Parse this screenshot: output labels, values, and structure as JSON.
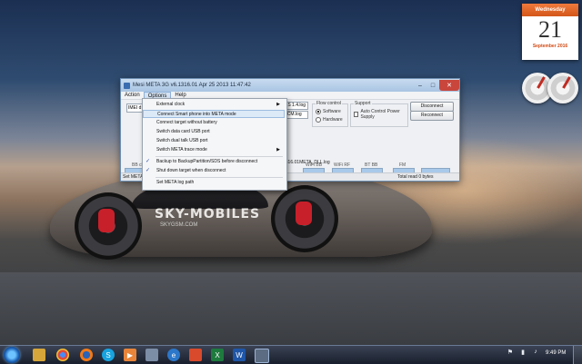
{
  "window": {
    "title": "Mesi META 3G v6.1316.01 Apr 25 2013 11:47:42",
    "minimize": "–",
    "maximize": "□",
    "close": "✕"
  },
  "menubar": [
    "Action",
    "Options",
    "Help"
  ],
  "form": {
    "imei_value": "IMEI d",
    "log_field_1": "ES 1.4.log",
    "log_field_2": "3CM.log",
    "flow_control_label": "Flow control",
    "flow_software": "Software",
    "flow_hardware": "Hardware",
    "support_label": "Support",
    "auto_power": "Auto Control Power Supply",
    "disconnect": "Disconnect",
    "reconnect": "Reconnect",
    "status_labels": [
      "BB ch",
      "WiFi BB",
      "WiFi RF",
      "BT BB",
      "FM"
    ],
    "log_path": "1316.01META_DLL.log"
  },
  "statusbar": {
    "left": "Set META",
    "total": "Total read 0 bytes"
  },
  "options_menu": [
    {
      "label": "External clock",
      "submenu": true
    },
    {
      "label": "Connect Smart phone into META mode",
      "highlighted": true
    },
    {
      "label": "Connect target without battery"
    },
    {
      "label": "Switch data card USB port"
    },
    {
      "label": "Switch dual talk USB port"
    },
    {
      "label": "Switch META trace mode",
      "submenu": true
    },
    {
      "label": "Backup to BackupPartition/SDS before disconnect",
      "checked": true
    },
    {
      "label": "Shut down target when disconnect",
      "checked": true
    },
    {
      "label": "Set META log path"
    }
  ],
  "calendar": {
    "weekday": "Wednesday",
    "day": "21",
    "month_year": "September 2016"
  },
  "decal": {
    "main": "SKY-MOBILES",
    "sub": "SKYGSM.COM"
  },
  "taskbar": {
    "time": "9:49 PM",
    "icons": [
      "folder-icon",
      "chrome-icon",
      "firefox-icon",
      "skype-icon",
      "media-player-icon",
      "app-icon",
      "ie-icon",
      "java-icon",
      "excel-icon",
      "word-icon",
      "meta-icon"
    ],
    "tray": [
      "flag-icon",
      "network-icon",
      "volume-icon"
    ]
  }
}
